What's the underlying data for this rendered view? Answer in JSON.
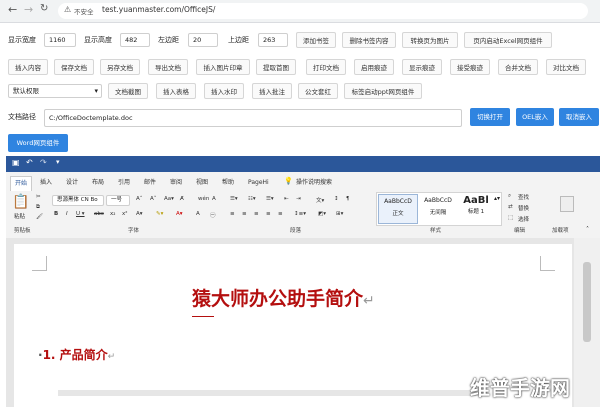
{
  "browser": {
    "address_label": "不安全",
    "url": "test.yuanmaster.com/OfficeJS/"
  },
  "controls": {
    "row1": [
      {
        "label": "显示宽度",
        "value": "1160"
      },
      {
        "label": "显示高度",
        "value": "482"
      },
      {
        "label": "左边距",
        "value": "20"
      },
      {
        "label": "上边距",
        "value": "263"
      }
    ],
    "row1_buttons": [
      "添加书签",
      "删除书签内容",
      "转换页为图片",
      "页内启动Excel网页组件"
    ],
    "row2_buttons": [
      "插入内容",
      "保存文档",
      "另存文档",
      "导出文档",
      "插入图片印章",
      "提取首图",
      "打印文档",
      "启用痕迹",
      "显示痕迹",
      "接受痕迹",
      "合并文档",
      "对比文档"
    ],
    "permission_select": "默认权限",
    "row3_buttons": [
      "文档截图",
      "插入表格",
      "插入水印",
      "插入批注",
      "公文套红",
      "标签启动ppt网页组件"
    ],
    "path_label": "文档路径",
    "path_value": "C:/OfficeDoctemplate.doc",
    "open_button": "切换打开",
    "embed_button": "OEL嵌入",
    "cancel_embed_button": "取消嵌入",
    "word_component_button": "Word网页组件"
  },
  "ribbon": {
    "tabs": [
      "开始",
      "插入",
      "设计",
      "布局",
      "引用",
      "邮件",
      "审阅",
      "视图",
      "帮助",
      "PageHi"
    ],
    "search": "操作说明搜索",
    "paste_label": "粘贴",
    "font_name": "思源黑体 CN Bo",
    "font_size": "一号",
    "styles": [
      {
        "preview": "AaBbCcD",
        "name": "正文"
      },
      {
        "preview": "AaBbCcD",
        "name": "无间隔"
      },
      {
        "preview": "AaBl",
        "name": "标题 1"
      }
    ],
    "edit_items": [
      "查找",
      "替换",
      "选择"
    ],
    "groups": [
      "剪贴板",
      "字体",
      "段落",
      "样式",
      "编辑",
      "加载项"
    ]
  },
  "document": {
    "title": "猿大师办公助手简介",
    "heading": "1. 产品简介"
  },
  "watermark": "维普手游网",
  "colors": {
    "accent": "#2f84e0",
    "word_blue": "#2b579a",
    "title_red": "#b40f0f"
  }
}
